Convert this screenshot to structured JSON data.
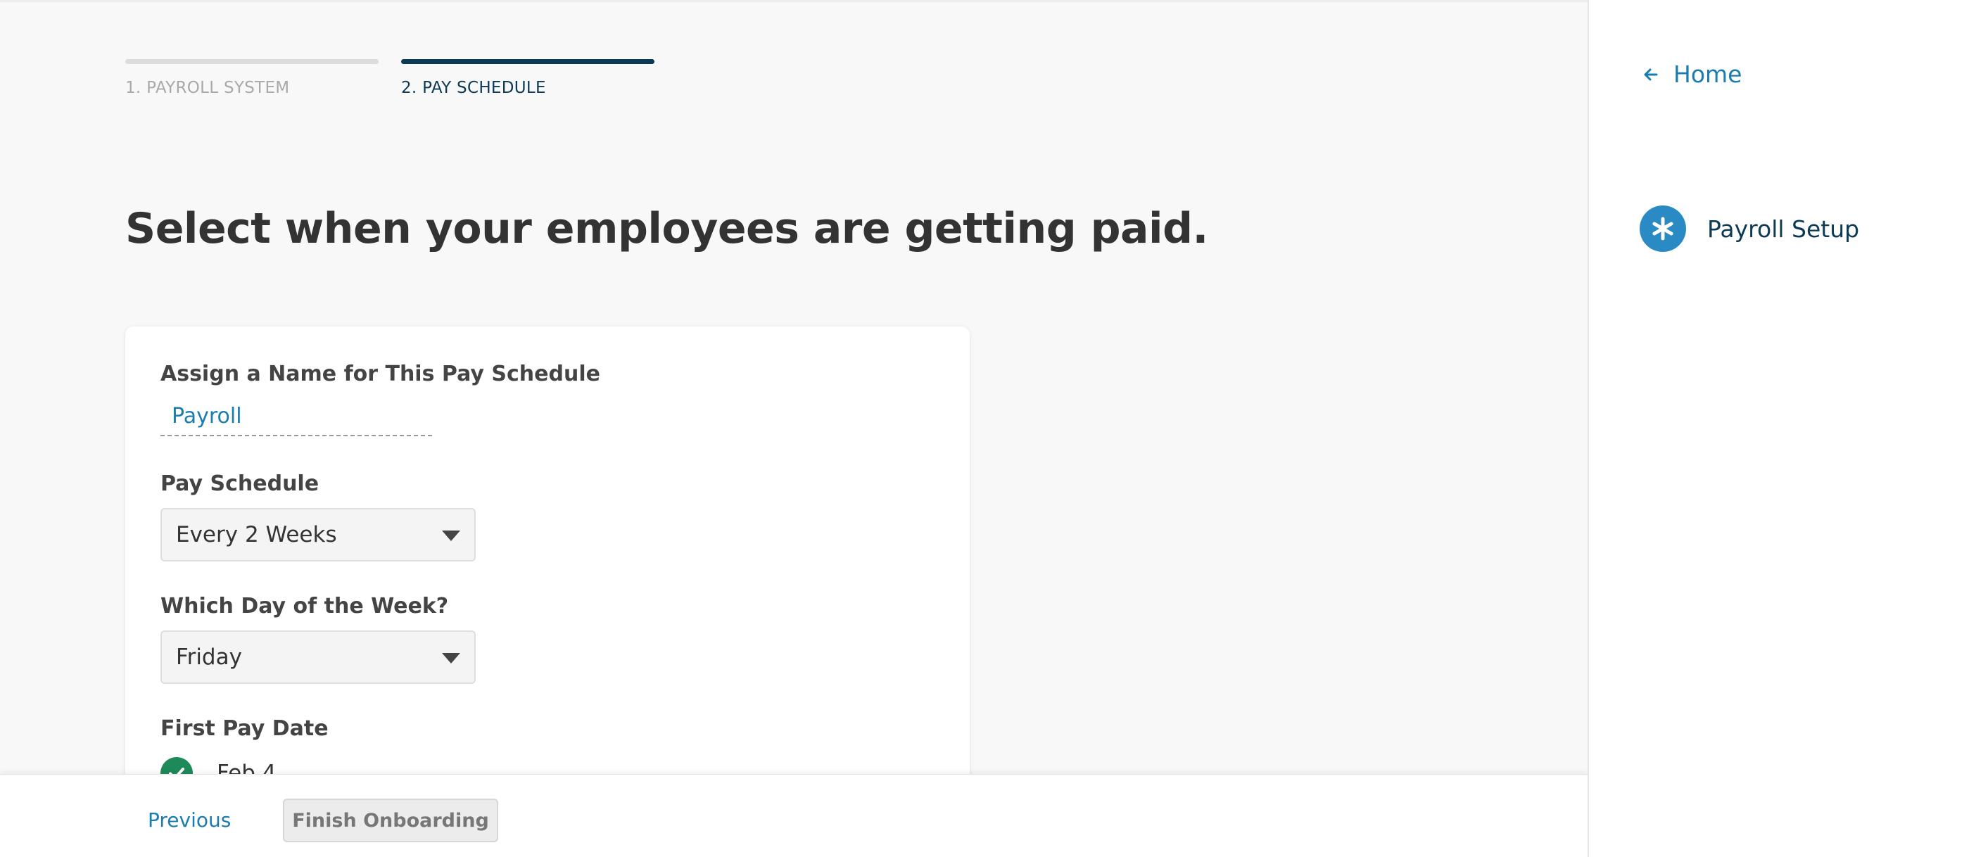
{
  "stepper": {
    "steps": [
      {
        "label": "1. PAYROLL SYSTEM",
        "state": "complete"
      },
      {
        "label": "2. PAY SCHEDULE",
        "state": "active"
      }
    ]
  },
  "page": {
    "title": "Select when your employees are getting paid."
  },
  "form": {
    "schedule_name": {
      "label": "Assign a Name for This Pay Schedule",
      "value": "Payroll"
    },
    "pay_schedule": {
      "label": "Pay Schedule",
      "value": "Every 2 Weeks"
    },
    "pay_day": {
      "label": "Which Day of the Week?",
      "value": "Friday"
    },
    "first_pay_date": {
      "label": "First Pay Date",
      "value": "Feb 4",
      "selected": true
    }
  },
  "footer": {
    "previous_label": "Previous",
    "finish_label": "Finish Onboarding"
  },
  "sidebar": {
    "home_label": "Home",
    "items": [
      {
        "label": "Payroll Setup",
        "icon": "asterisk-icon"
      }
    ]
  },
  "colors": {
    "accent": "#1a7db0",
    "navy": "#0c3a55",
    "success": "#1e8a5a",
    "icon_blue": "#2a8bc4"
  }
}
